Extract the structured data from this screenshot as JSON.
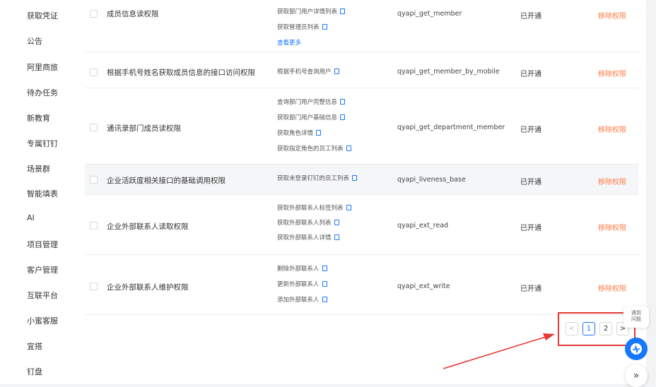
{
  "sidebar": {
    "items": [
      "获取凭证",
      "公告",
      "阿里商旅",
      "待办任务",
      "新教育",
      "专属钉钉",
      "场景群",
      "智能填表",
      "AI",
      "项目管理",
      "客户管理",
      "互联平台",
      "小蜜客服",
      "宜搭",
      "钉盘"
    ]
  },
  "rows": [
    {
      "name": "成员信息读权限",
      "apis": [
        "获取部门用户详情列表",
        "获取管理员列表"
      ],
      "more": "查看更多",
      "code": "qyapi_get_member",
      "status": "已开通",
      "action": "移除权限"
    },
    {
      "name": "根据手机号姓名获取成员信息的接口访问权限",
      "apis": [
        "根据手机号查询用户"
      ],
      "code": "qyapi_get_member_by_mobile",
      "status": "已开通",
      "action": "移除权限"
    },
    {
      "name": "通讯录部门成员读权限",
      "apis": [
        "查询部门用户完整信息",
        "获取部门用户基础信息",
        "获取角色详情",
        "获取指定角色的员工列表"
      ],
      "code": "qyapi_get_department_member",
      "status": "已开通",
      "action": "移除权限"
    },
    {
      "name": "企业活跃度相关接口的基础调用权限",
      "apis": [
        "获取未登录钉钉的员工列表"
      ],
      "code": "qyapi_liveness_base",
      "status": "已开通",
      "action": "移除权限"
    },
    {
      "name": "企业外部联系人读取权限",
      "apis": [
        "获取外部联系人标签列表",
        "获取外部联系人列表",
        "获取外部联系人详情"
      ],
      "code": "qyapi_ext_read",
      "status": "已开通",
      "action": "移除权限"
    },
    {
      "name": "企业外部联系人维护权限",
      "apis": [
        "删除外部联系人",
        "更新外部联系人",
        "添加外部联系人"
      ],
      "code": "qyapi_ext_write",
      "status": "已开通",
      "action": "移除权限"
    }
  ],
  "pagination": {
    "prev": "<",
    "pages": [
      "1",
      "2"
    ],
    "current": "1",
    "next": ">"
  },
  "float": {
    "help_line1": "遇到",
    "help_line2": "问题",
    "expand": "»"
  },
  "colors": {
    "accent": "#1677ff",
    "danger": "#ff7a45",
    "annotation": "#e53935"
  }
}
